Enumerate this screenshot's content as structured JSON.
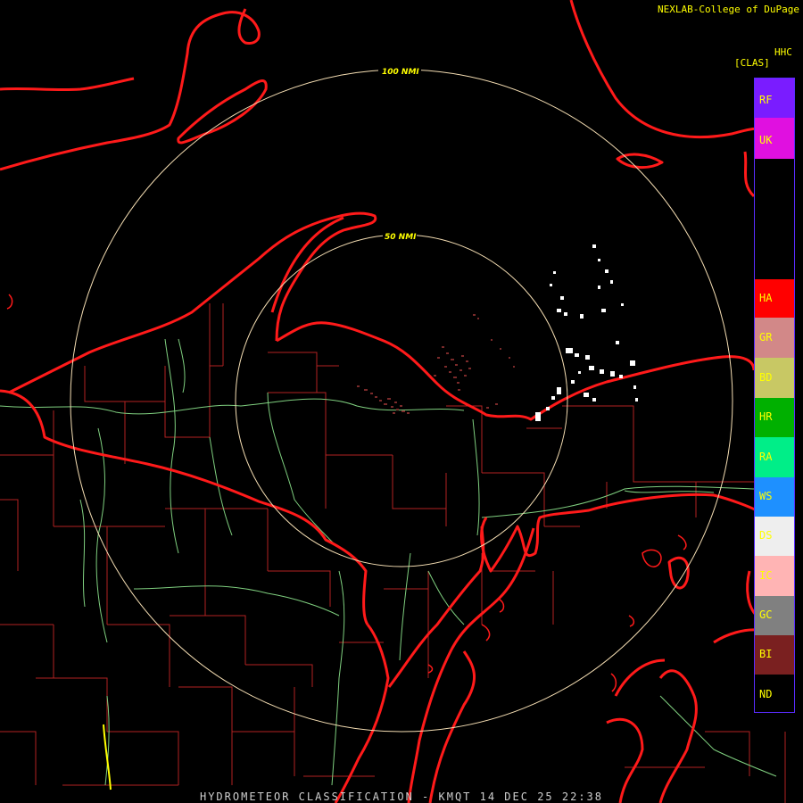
{
  "header": {
    "credit": "NEXLAB-College of DuPage"
  },
  "footer": {
    "title": "HYDROMETEOR CLASSIFICATION - KMQT 14 DEC 25 22:38"
  },
  "legend": {
    "product": "HHC",
    "subtitle": "[CLAS]",
    "classes": [
      {
        "code": "RF",
        "color": "#7a1cff"
      },
      {
        "code": "UK",
        "color": "#e010e0"
      },
      {
        "code": "HA",
        "color": "#ff0000"
      },
      {
        "code": "GR",
        "color": "#d28888"
      },
      {
        "code": "BD",
        "color": "#c8c864"
      },
      {
        "code": "HR",
        "color": "#00b000"
      },
      {
        "code": "RA",
        "color": "#00ee88"
      },
      {
        "code": "WS",
        "color": "#1e90ff"
      },
      {
        "code": "DS",
        "color": "#eeeeee"
      },
      {
        "code": "IC",
        "color": "#ffb4b4"
      },
      {
        "code": "GC",
        "color": "#808080"
      },
      {
        "code": "BI",
        "color": "#7a2020"
      },
      {
        "code": "ND",
        "color": "#000000"
      }
    ]
  },
  "range_rings": [
    {
      "label": "100 NMI"
    },
    {
      "label": "50 NMI"
    }
  ],
  "colors": {
    "coastline": "#ff1a1a",
    "county_lines": "#b22222",
    "rivers": "#7fcf7f",
    "range_rings": "#f5deb3",
    "dry_snow_echo": "#ffffff",
    "biological_echo": "#7a2a2a"
  }
}
